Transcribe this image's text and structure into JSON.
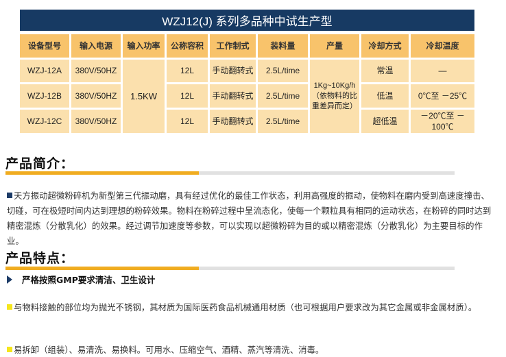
{
  "table": {
    "title": "WZJ12(J) 系列多品种中试生产型",
    "headers": [
      "设备型号",
      "输入电源",
      "输入功率",
      "公称容积",
      "工作制式",
      "装料量",
      "产量",
      "冷却方式",
      "冷却温度"
    ],
    "rows": [
      {
        "model": "WZJ-12A",
        "power_supply": "380V/50HZ",
        "volume": "12L",
        "mode": "手动翻转式",
        "load": "2.5L/time",
        "cooling": "常温",
        "temp": "—"
      },
      {
        "model": "WZJ-12B",
        "power_supply": "380V/50HZ",
        "volume": "12L",
        "mode": "手动翻转式",
        "load": "2.5L/time",
        "cooling": "低温",
        "temp": "0℃至 －25℃"
      },
      {
        "model": "WZJ-12C",
        "power_supply": "380V/50HZ",
        "volume": "12L",
        "mode": "手动翻转式",
        "load": "2.5L/time",
        "cooling": "超低温",
        "temp": "－20℃至 －100℃"
      }
    ],
    "input_power": "1.5KW",
    "output_lines": [
      "1Kg~10Kg/h",
      "（依物料的比",
      "重差异而定）"
    ]
  },
  "intro": {
    "heading": "产品简介：",
    "text": "天方振动超微粉碎机为新型第三代振动磨，具有经过优化的最佳工作状态，利用高强度的振动，使物料在磨内受到高速度撞击、切碰，可在极短时间内达到理想的粉碎效果。物料在粉碎过程中呈流态化，使每一个颗粒具有相同的运动状态，在粉碎的同时达到精密混炼（分散乳化）的效果。经过调节加速度等参数，可以实现以超微粉碎为目的或以精密混炼（分散乳化）为主要目标的作业。"
  },
  "features": {
    "heading": "产品特点：",
    "subheading": "严格按照GMP要求清洁、卫生设计",
    "items": [
      "与物料接触的部位均为抛光不锈钢，其材质为国际医药食品机械通用材质（也可根据用户要求改为其它金属或非金属材质）。",
      "易拆卸（组装）、易清洗、易换料。可用水、压缩空气、酒精、蒸汽等清洗、消毒。"
    ]
  },
  "colors": {
    "title_bg": "#173a63",
    "header_bg": "#f8c36b",
    "cell_bg": "#fbe0ad",
    "accent": "#f0ac20",
    "bullet_navy": "#1d3c68",
    "bullet_yellow": "#f5e61c"
  }
}
